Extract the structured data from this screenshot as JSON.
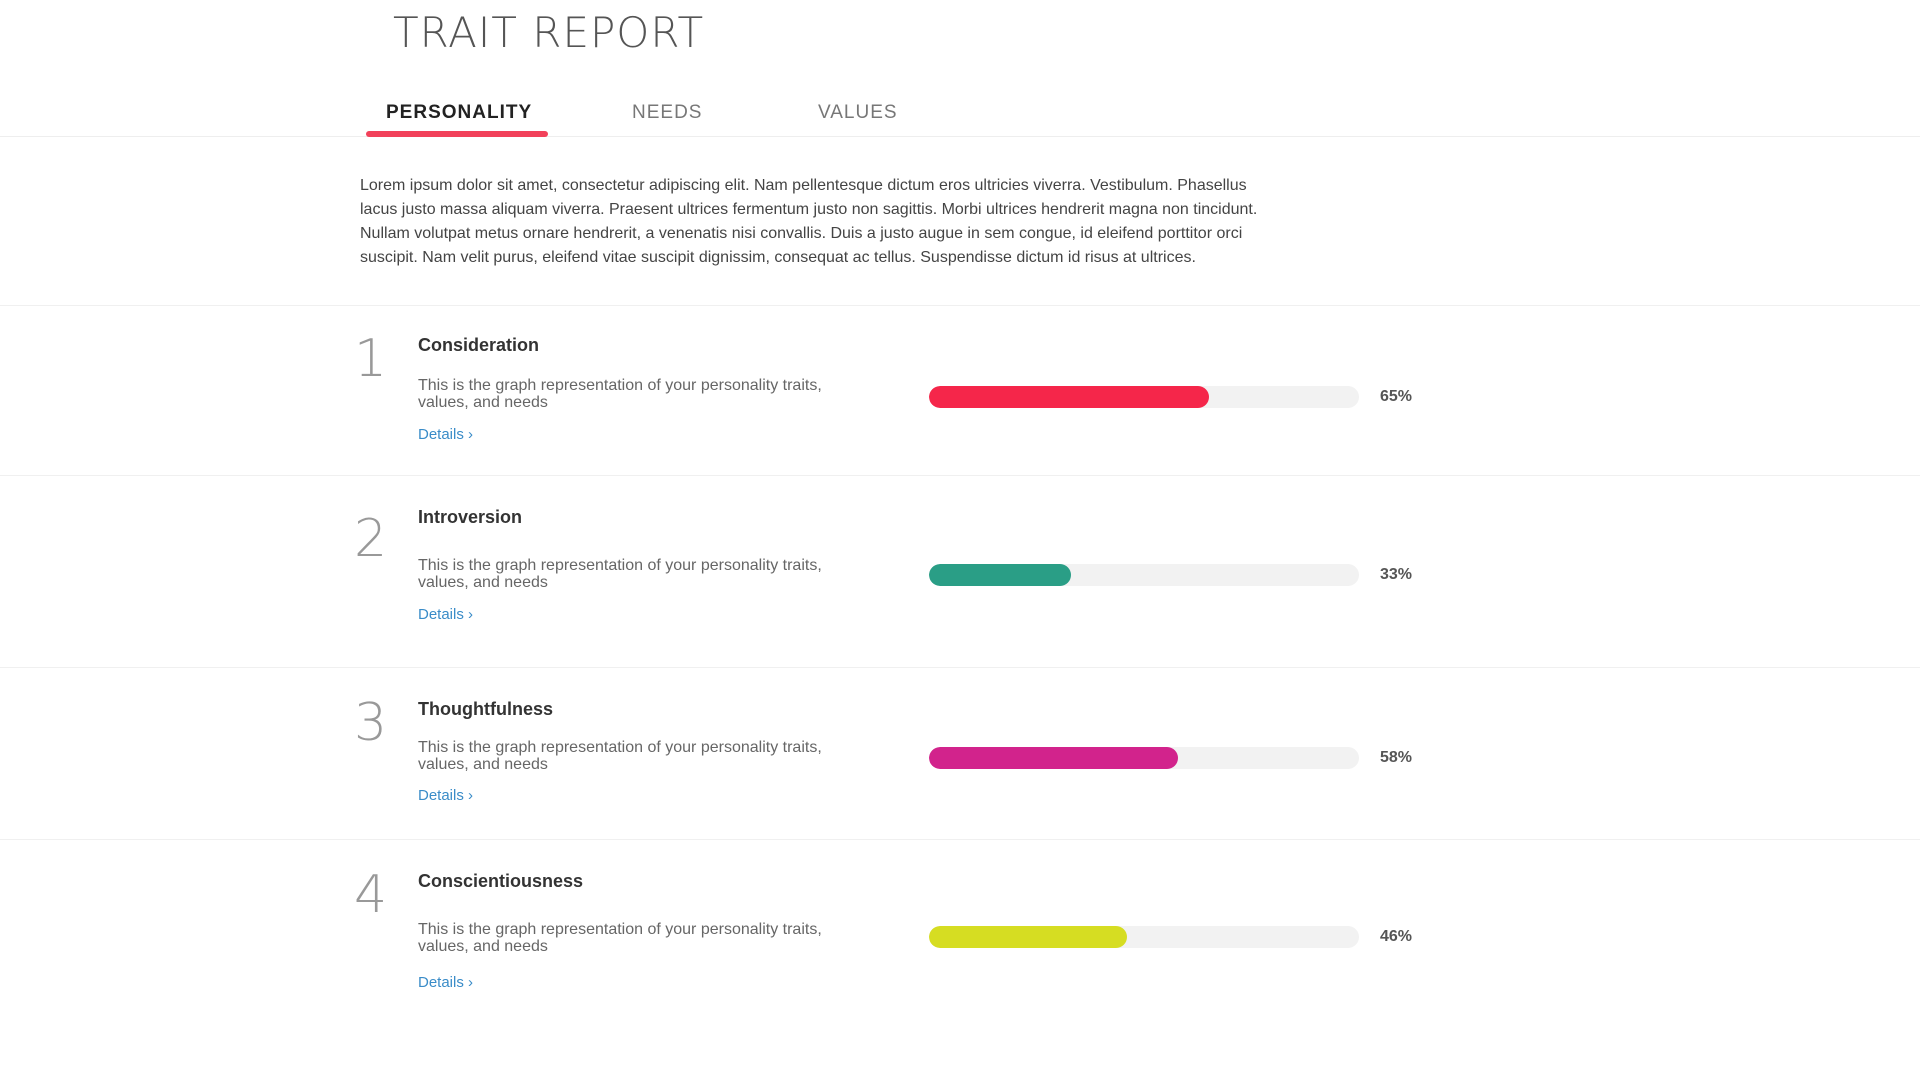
{
  "header": {
    "title": "TRAIT REPORT"
  },
  "tabs": [
    {
      "label": "PERSONALITY",
      "active": true
    },
    {
      "label": "NEEDS",
      "active": false
    },
    {
      "label": "VALUES",
      "active": false
    }
  ],
  "intro": "Lorem ipsum dolor sit amet, consectetur adipiscing elit. Nam pellentesque dictum eros ultricies viverra. Vestibulum. Phasellus lacus justo massa aliquam viverra. Praesent ultrices fermentum justo non sagittis. Morbi ultrices hendrerit magna non tincidunt. Nullam volutpat metus ornare hendrerit, a venenatis nisi convallis. Duis a justo augue in sem congue, id eleifend porttitor orci suscipit. Nam velit purus, eleifend vitae suscipit dignissim, consequat ac tellus. Suspendisse dictum id risus at ultrices.",
  "traits": [
    {
      "number": "1",
      "name": "Consideration",
      "description": "This is the graph representation of your personality traits, values, and needs",
      "link": "Details ›",
      "percent_label": "65%",
      "value": 0.65,
      "color": "#f5264a"
    },
    {
      "number": "2",
      "name": "Introversion",
      "description": "This is the graph representation of your personality traits, values, and needs",
      "link": "Details ›",
      "percent_label": "33%",
      "value": 0.33,
      "color": "#2a9e86"
    },
    {
      "number": "3",
      "name": "Thoughtfulness",
      "description": "This is the graph representation of your personality traits, values, and needs",
      "link": "Details ›",
      "percent_label": "58%",
      "value": 0.58,
      "color": "#d2238c"
    },
    {
      "number": "4",
      "name": "Conscientiousness",
      "description": "This is the graph representation of your personality traits, values, and needs",
      "link": "Details ›",
      "percent_label": "46%",
      "value": 0.46,
      "color": "#d6dd22"
    }
  ]
}
